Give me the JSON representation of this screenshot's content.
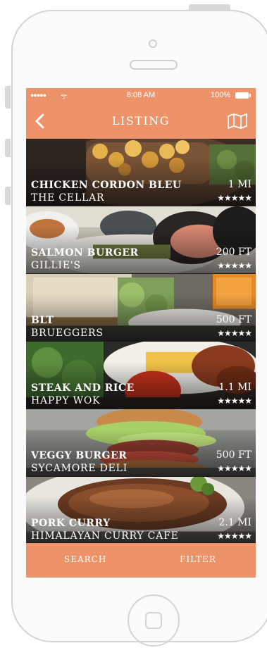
{
  "status_bar": {
    "signal": "●●●●●",
    "wifi": "ᯤ",
    "time": "8:08 AM",
    "battery": "100%"
  },
  "nav": {
    "title": "LISTING",
    "back_icon": "chevron-left-icon",
    "map_icon": "map-icon"
  },
  "items": [
    {
      "name": "CHICKEN CORDON BLEU",
      "place": "THE CELLAR",
      "distance": "1 MI",
      "stars": "★★★★★",
      "rating": 5
    },
    {
      "name": "SALMON BURGER",
      "place": "GILLIE'S",
      "distance": "200 FT",
      "stars": "★★★★★",
      "rating": 5
    },
    {
      "name": "BLT",
      "place": "BRUEGGERS",
      "distance": "500 FT",
      "stars": "★★★★★",
      "rating": 5
    },
    {
      "name": "STEAK AND RICE",
      "place": "HAPPY WOK",
      "distance": "1.1 MI",
      "stars": "★★★★★",
      "rating": 5
    },
    {
      "name": "VEGGY BURGER",
      "place": "SYCAMORE DELI",
      "distance": "500 FT",
      "stars": "★★★★★",
      "rating": 5
    },
    {
      "name": "PORK CURRY",
      "place": "HIMALAYAN CURRY CAFE",
      "distance": "2.1 MI",
      "stars": "★★★★★",
      "rating": 5
    }
  ],
  "tabs": {
    "search": "SEARCH",
    "filter": "FILTER"
  },
  "colors": {
    "accent": "#ee9369"
  }
}
